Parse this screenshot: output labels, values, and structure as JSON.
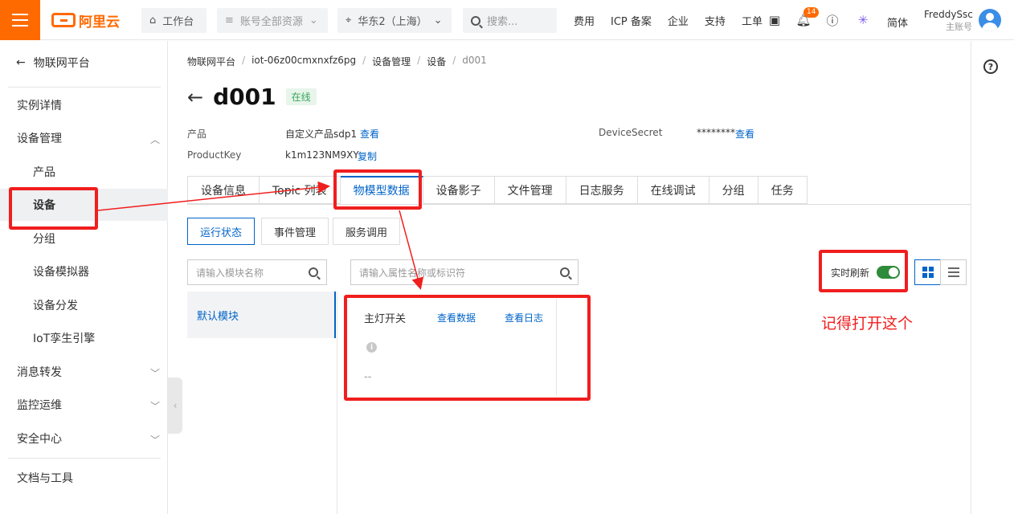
{
  "topbar": {
    "logo": "阿里云",
    "workbench": "工作台",
    "resources": "账号全部资源",
    "region": "华东2（上海）",
    "search_placeholder": "搜索...",
    "links": [
      "费用",
      "ICP 备案",
      "企业",
      "支持",
      "工单"
    ],
    "notification_count": "14",
    "language": "简体",
    "user_name": "FreddySsc",
    "user_role": "主账号"
  },
  "sidebar": {
    "back_label": "物联网平台",
    "items": [
      {
        "label": "实例详情"
      },
      {
        "label": "设备管理"
      },
      {
        "label": "产品"
      },
      {
        "label": "设备"
      },
      {
        "label": "分组"
      },
      {
        "label": "设备模拟器"
      },
      {
        "label": "设备分发"
      },
      {
        "label": "IoT孪生引擎"
      },
      {
        "label": "消息转发"
      },
      {
        "label": "监控运维"
      },
      {
        "label": "安全中心"
      },
      {
        "label": "文档与工具"
      }
    ]
  },
  "breadcrumb": [
    "物联网平台",
    "iot-06z00cmxnxfz6pg",
    "设备管理",
    "设备",
    "d001"
  ],
  "device": {
    "name": "d001",
    "status": "在线",
    "product_label": "产品",
    "product_value": "自定义产品sdp1",
    "product_link": "查看",
    "productkey_label": "ProductKey",
    "productkey_value": "k1m123NM9XY",
    "productkey_link": "复制",
    "secret_label": "DeviceSecret",
    "secret_value": "********",
    "secret_link": "查看"
  },
  "tabs": [
    "设备信息",
    "Topic 列表",
    "物模型数据",
    "设备影子",
    "文件管理",
    "日志服务",
    "在线调试",
    "分组",
    "任务"
  ],
  "subtabs": [
    "运行状态",
    "事件管理",
    "服务调用"
  ],
  "module_search_placeholder": "请输入模块名称",
  "property_search_placeholder": "请输入属性名称或标识符",
  "module_item": "默认模块",
  "card": {
    "name": "主灯开关",
    "view_data": "查看数据",
    "view_log": "查看日志",
    "value": "--"
  },
  "realtime_label": "实时刷新",
  "annotation_text": "记得打开这个",
  "colors": {
    "brand": "#ff6a00",
    "link": "#0064c8",
    "annotation": "#f01e1e",
    "toggle_on": "#2e8b3a"
  }
}
